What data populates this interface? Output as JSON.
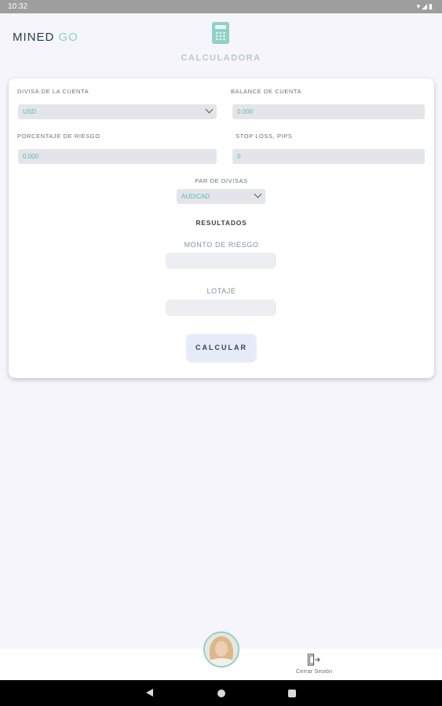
{
  "status": {
    "time": "10:32",
    "icons": [
      "wifi-icon",
      "signal-icon",
      "battery-icon"
    ]
  },
  "header": {
    "logo_main": "MINED",
    "logo_accent": "GO",
    "title": "CALCULADORA"
  },
  "form": {
    "account_currency": {
      "label": "DIVISA DE LA CUENTA",
      "value": "USD"
    },
    "account_balance": {
      "label": "BALANCE DE CUENTA",
      "value": "0.000"
    },
    "risk_percentage": {
      "label": "PORCENTAJE DE RIESGO",
      "value": "0.000"
    },
    "stop_loss": {
      "label": "STOP LOSS, PIPS",
      "value": "0"
    },
    "currency_pair": {
      "label": "PAR DE DIVISAS",
      "value": "AUD/CAD"
    }
  },
  "results": {
    "title": "RESULTADOS",
    "risk_amount_label": "MONTO DE RIESGO",
    "risk_amount_value": "",
    "lot_size_label": "LOTAJE",
    "lot_size_value": ""
  },
  "actions": {
    "calculate_label": "CALCULAR"
  },
  "bottom": {
    "logout_label": "Cerrar Sesión"
  },
  "colors": {
    "accent": "#8fd1c8",
    "field_text": "#5fb9ad",
    "background": "#f5f5fb"
  }
}
